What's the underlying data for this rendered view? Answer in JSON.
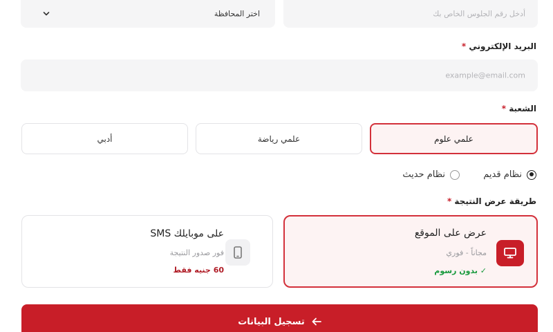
{
  "top_row": {
    "seat_number": {
      "placeholder": "أدخل رقم الجلوس الخاص بك"
    },
    "governorate": {
      "selected": "اختر المحافظة"
    }
  },
  "email": {
    "label": "البريد الإلكتروني",
    "required_mark": "*",
    "placeholder": "example@email.com"
  },
  "branch": {
    "label": "الشعبة",
    "required_mark": "*",
    "options": [
      "علمي علوم",
      "علمي رياضة",
      "أدبي"
    ],
    "selected": "علمي علوم"
  },
  "system": {
    "options": [
      "نظام قديم",
      "نظام حديث"
    ],
    "selected": "نظام قديم"
  },
  "result_method": {
    "label": "طريقة عرض النتيجة",
    "required_mark": "*",
    "cards": [
      {
        "title": "عرض على الموقع",
        "subtitle": "مجاناً - فوري",
        "note": "✓ بدون رسوم",
        "note_color": "#1a9a3e",
        "icon": "monitor-icon"
      },
      {
        "title": "على موبايلك SMS",
        "subtitle": "فور صدور النتيجة",
        "note": "60 جنيه فقط",
        "note_color": "#b01c26",
        "icon": "smartphone-icon"
      }
    ]
  },
  "submit": {
    "label": "تسجيل البيانات",
    "icon": "arrow-left-icon"
  },
  "colors": {
    "accent": "#c81e28",
    "active_border": "#d3303a",
    "active_bg": "#fdf3f3"
  }
}
